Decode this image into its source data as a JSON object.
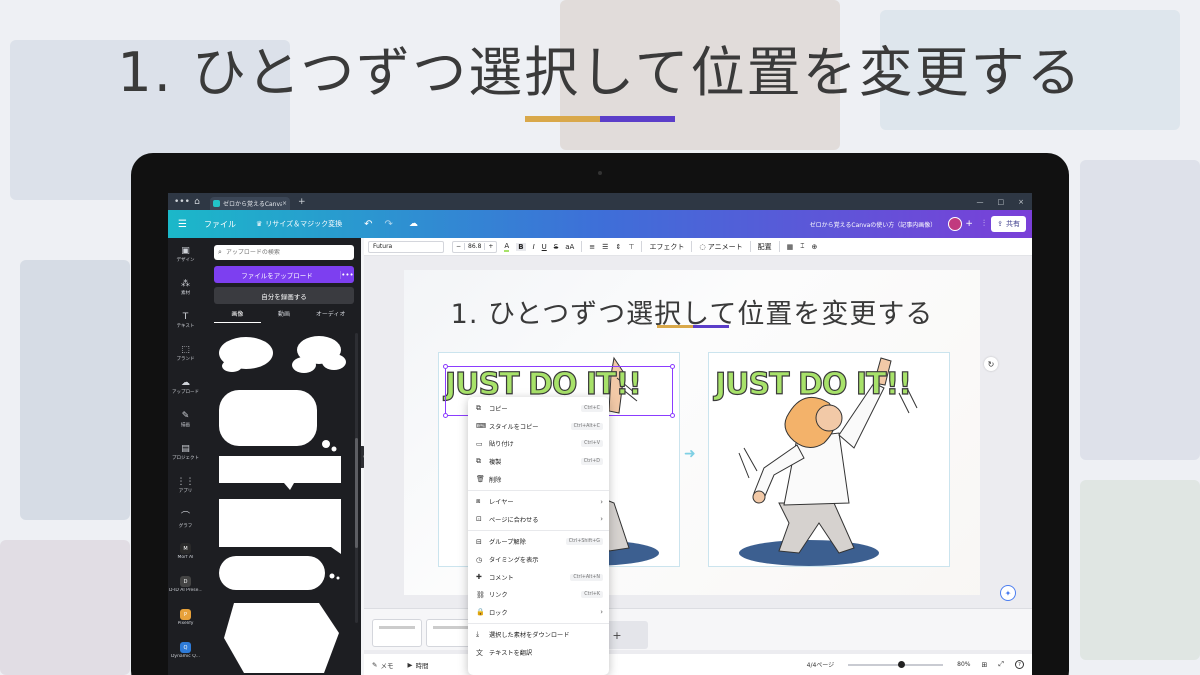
{
  "heading": "1. ひとつずつ選択して位置を変更する",
  "colors": {
    "accent_gold": "#d9a84a",
    "accent_purple": "#5b3ec9",
    "canva_purple": "#7d3ff0"
  },
  "browser": {
    "tab_label": "ゼロから覚えるCanva",
    "tab_close": "×",
    "new_tab": "+",
    "win_controls": [
      "—",
      "□",
      "×"
    ]
  },
  "topbar": {
    "menu_icon": "☰",
    "file_label": "ファイル",
    "resize_label": "リサイズ＆マジック変換",
    "doc_title": "ゼロから覚えるCanvaの使い方（記事内画像）",
    "avatar_plus": "+",
    "share_label": "共有"
  },
  "rail": [
    {
      "icon": "▣",
      "label": "デザイン"
    },
    {
      "icon": "⁂",
      "label": "素材"
    },
    {
      "icon": "T",
      "label": "テキスト"
    },
    {
      "icon": "⬚",
      "label": "ブランド"
    },
    {
      "icon": "☁",
      "label": "アップロード"
    },
    {
      "icon": "✎",
      "label": "描画"
    },
    {
      "icon": "▤",
      "label": "プロジェクト"
    },
    {
      "icon": "⋮⋮",
      "label": "アプリ"
    },
    {
      "icon": "⌒",
      "label": "グラフ"
    },
    {
      "icon": "M",
      "label": "Morf AI",
      "app_color": "#2a2a2a"
    },
    {
      "icon": "D",
      "label": "D-ID AI Prese...",
      "app_color": "#444"
    },
    {
      "icon": "P",
      "label": "Pixelify",
      "app_color": "#e7a13a"
    },
    {
      "icon": "Q",
      "label": "Dynamic Q...",
      "app_color": "#2e7bd8"
    }
  ],
  "panel": {
    "search_placeholder": "アップロードの検索",
    "upload_label": "ファイルをアップロード",
    "upload_more": "•••",
    "record_label": "自分を録画する",
    "tabs": [
      "画像",
      "動画",
      "オーディオ"
    ]
  },
  "toolbar": {
    "font": "Futura",
    "size_minus": "−",
    "size": "86.8",
    "size_plus": "+",
    "effect": "エフェクト",
    "animate": "アニメート",
    "position": "配置"
  },
  "slide": {
    "title": "1. ひとつずつ選択して位置を変更する",
    "jdi_left": "JUST DO IT!!",
    "jdi_right": "JUST DO IT!!",
    "arrow": "➜"
  },
  "context_menu": [
    {
      "icon": "⧉",
      "label": "コピー",
      "key": "Ctrl+C"
    },
    {
      "icon": "⌨",
      "label": "スタイルをコピー",
      "key": "Ctrl+Alt+C"
    },
    {
      "icon": "▭",
      "label": "貼り付け",
      "key": "Ctrl+V"
    },
    {
      "icon": "⧉",
      "label": "複製",
      "key": "Ctrl+D"
    },
    {
      "icon": "🗑",
      "label": "削除",
      "key": ""
    },
    {
      "sep": true
    },
    {
      "icon": "⧈",
      "label": "レイヤー",
      "chevron": "›"
    },
    {
      "icon": "⊡",
      "label": "ページに合わせる",
      "chevron": "›"
    },
    {
      "sep": true
    },
    {
      "icon": "⊟",
      "label": "グループ解除",
      "key": "Ctrl+Shift+G"
    },
    {
      "icon": "◷",
      "label": "タイミングを表示",
      "key": ""
    },
    {
      "icon": "✚",
      "label": "コメント",
      "key": "Ctrl+Alt+N"
    },
    {
      "icon": "⛓",
      "label": "リンク",
      "key": "Ctrl+K"
    },
    {
      "icon": "🔒",
      "label": "ロック",
      "chevron": "›"
    },
    {
      "sep": true
    },
    {
      "icon": "⤓",
      "label": "選択した素材をダウンロード",
      "key": ""
    },
    {
      "icon": "文",
      "label": "テキストを翻訳",
      "key": ""
    }
  ],
  "bottom": {
    "add_page": "+",
    "memo": "メモ",
    "timing": "時間",
    "page_count": "4/4ページ",
    "zoom": "80%",
    "help": "?"
  }
}
